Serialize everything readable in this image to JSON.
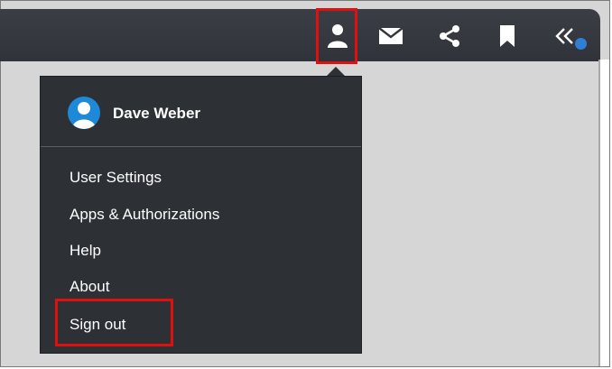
{
  "toolbar": {
    "icons": [
      "user-icon",
      "mail-icon",
      "share-icon",
      "bookmark-icon",
      "collapse-icon"
    ],
    "notification_dot_color": "#2f7fd6"
  },
  "menu": {
    "user_name": "Dave Weber",
    "items": [
      "User Settings",
      "Apps & Authorizations",
      "Help",
      "About",
      "Sign out"
    ]
  },
  "colors": {
    "highlight": "#e01010",
    "menu_bg": "#2d3035",
    "avatar": "#1e88d9"
  }
}
